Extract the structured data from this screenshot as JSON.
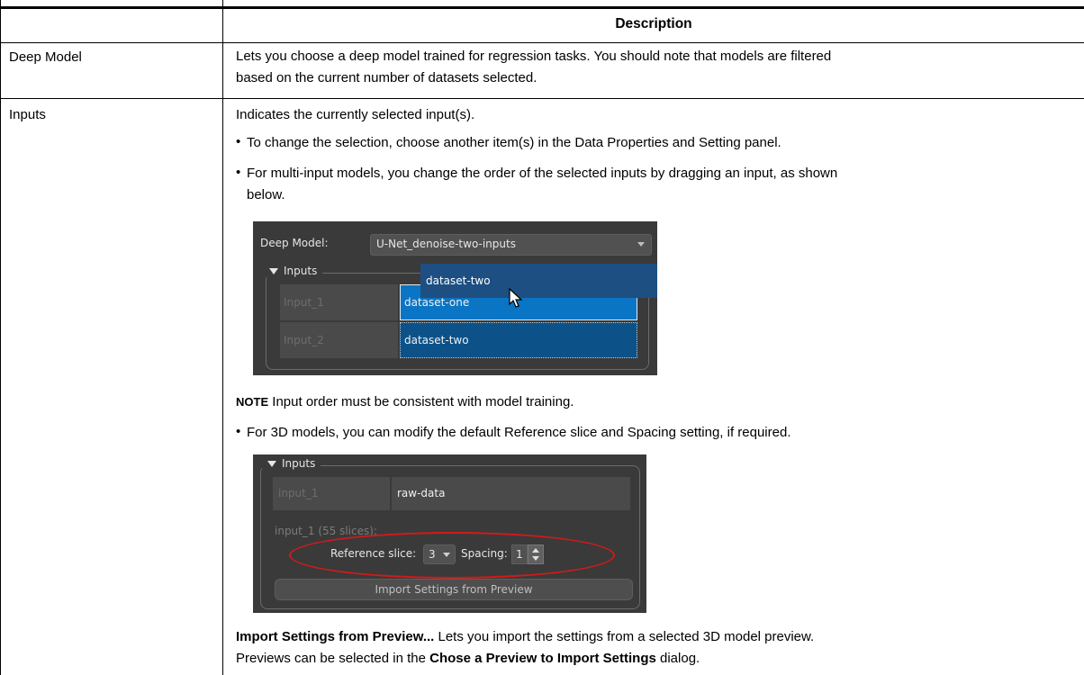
{
  "table": {
    "header": "Description",
    "rows": [
      {
        "name": "Deep Model",
        "description_lines": [
          "Lets you choose a deep model trained for regression tasks. You should note that models are filtered",
          "based on the current number of datasets selected."
        ]
      },
      {
        "name": "Inputs",
        "intro": "Indicates the currently selected input(s).",
        "bullet1": "To change the selection, choose another item(s) in the Data Properties and Setting panel.",
        "bullet2_lines": [
          "For multi-input models, you change the order of the selected inputs by dragging an input, as shown",
          "below."
        ],
        "note_label": "NOTE",
        "note_text": " Input order must be consistent with model training.",
        "bullet3": "For 3D models, you can modify the default Reference slice and Spacing setting, if required.",
        "import_label": "Import Settings from Preview...",
        "import_text1": " Lets you import the settings from a selected 3D model preview.",
        "import_text2_before": "Previews can be selected in the ",
        "import_text2_bold": "Chose a Preview to Import Settings",
        "import_text2_after": " dialog."
      }
    ]
  },
  "screenshot1": {
    "deep_model_label": "Deep Model:",
    "deep_model_value": "U-Net_denoise-two-inputs",
    "inputs_title": "Inputs",
    "inputs": [
      {
        "label": "Input_1",
        "value": "dataset-one"
      },
      {
        "label": "Input_2",
        "value": "dataset-two"
      }
    ],
    "drag_value": "dataset-two"
  },
  "screenshot2": {
    "inputs_title": "Inputs",
    "input_label": "input_1",
    "input_value": "raw-data",
    "slices_text": "input_1 (55 slices):",
    "reference_label": "Reference slice:",
    "reference_value": "3",
    "spacing_label": "Spacing:",
    "spacing_value": "1",
    "import_button": "Import Settings from Preview"
  },
  "colors": {
    "panel_bg": "#3a3a3a",
    "selection_blue": "#1d4f83",
    "highlight_blue": "#0a75c4",
    "ellipse_red": "#d11a1a"
  }
}
